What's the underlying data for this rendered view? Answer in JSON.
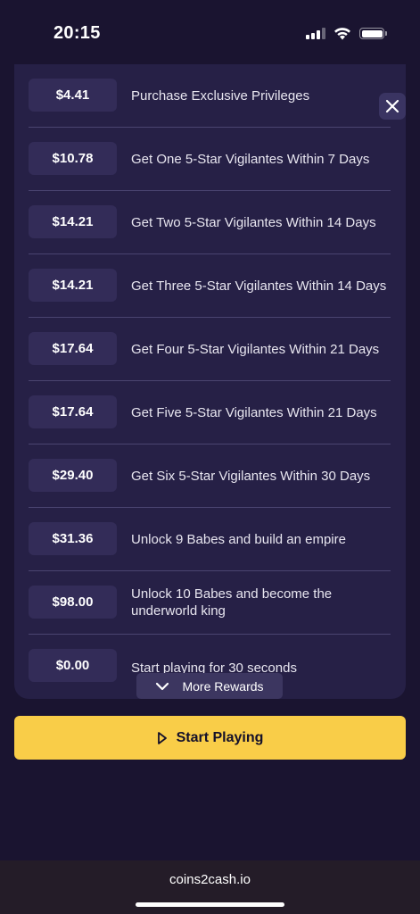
{
  "status_bar": {
    "time": "20:15",
    "signal_icon": "cellular-signal-icon",
    "wifi_icon": "wifi-icon",
    "battery_icon": "battery-icon"
  },
  "rewards": [
    {
      "price": "$4.41",
      "description": "Purchase Exclusive Privileges"
    },
    {
      "price": "$10.78",
      "description": "Get One 5-Star Vigilantes Within 7 Days"
    },
    {
      "price": "$14.21",
      "description": "Get Two 5-Star Vigilantes Within 14 Days"
    },
    {
      "price": "$14.21",
      "description": "Get Three 5-Star Vigilantes Within 14 Days"
    },
    {
      "price": "$17.64",
      "description": "Get Four 5-Star Vigilantes Within 21 Days"
    },
    {
      "price": "$17.64",
      "description": "Get Five 5-Star Vigilantes Within 21 Days"
    },
    {
      "price": "$29.40",
      "description": "Get Six 5-Star Vigilantes Within 30 Days"
    },
    {
      "price": "$31.36",
      "description": "Unlock 9 Babes and build an empire"
    },
    {
      "price": "$98.00",
      "description": "Unlock 10 Babes and become the underworld king"
    },
    {
      "price": "$0.00",
      "description": "Start playing for 30 seconds"
    }
  ],
  "close_icon": "close-icon",
  "more_rewards": {
    "label": "More Rewards",
    "icon": "chevron-down-icon"
  },
  "start_button": {
    "label": "Start Playing",
    "icon": "play-icon"
  },
  "url_bar": {
    "domain": "coins2cash.io"
  },
  "colors": {
    "background": "#1a1430",
    "panel": "#262046",
    "price_badge": "#332c58",
    "accent_yellow": "#f9cd48"
  }
}
